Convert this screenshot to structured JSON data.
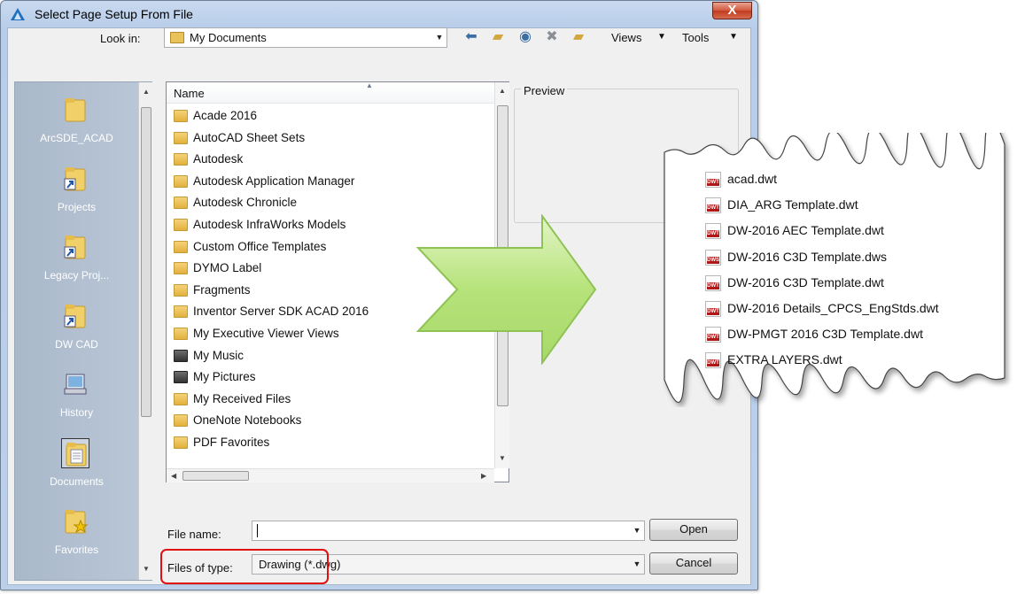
{
  "window": {
    "title": "Select Page Setup From File",
    "close_glyph": "X"
  },
  "toolbar": {
    "lookin_label": "Look in:",
    "lookin_value": "My Documents",
    "views_label": "Views",
    "tools_label": "Tools",
    "icons": [
      "back-arrow-icon",
      "up-folder-icon",
      "search-web-icon",
      "delete-icon",
      "new-folder-icon"
    ]
  },
  "places": [
    {
      "label": "ArcSDE_ACAD",
      "icon": "folder-icon"
    },
    {
      "label": "Projects",
      "icon": "folder-shortcut-icon"
    },
    {
      "label": "Legacy Proj...",
      "icon": "folder-shortcut-icon"
    },
    {
      "label": "DW CAD",
      "icon": "folder-shortcut-icon"
    },
    {
      "label": "History",
      "icon": "history-icon"
    },
    {
      "label": "Documents",
      "icon": "documents-icon",
      "selected": true
    },
    {
      "label": "Favorites",
      "icon": "favorites-folder-icon"
    }
  ],
  "filelist": {
    "column_name": "Name",
    "items": [
      "Acade 2016",
      "AutoCAD Sheet Sets",
      "Autodesk",
      "Autodesk Application Manager",
      "Autodesk Chronicle",
      "Autodesk InfraWorks Models",
      "Custom Office Templates",
      "DYMO Label",
      "Fragments",
      "Inventor Server SDK ACAD 2016",
      "My Executive Viewer Views",
      "My Music",
      "My Pictures",
      "My Received Files",
      "OneNote Notebooks",
      "PDF Favorites"
    ]
  },
  "preview": {
    "label": "Preview"
  },
  "bottom": {
    "filename_label": "File name:",
    "filename_value": "",
    "filetype_label": "Files of type:",
    "filetype_value": "Drawing (*.dwg)",
    "open_label": "Open",
    "cancel_label": "Cancel"
  },
  "callout": {
    "files": [
      {
        "name": "acad.dwt",
        "icon": "DWT"
      },
      {
        "name": "DIA_ARG Template.dwt",
        "icon": "DWT"
      },
      {
        "name": "DW-2016 AEC Template.dwt",
        "icon": "DWT"
      },
      {
        "name": "DW-2016 C3D Template.dws",
        "icon": "DWS"
      },
      {
        "name": "DW-2016 C3D Template.dwt",
        "icon": "DWT"
      },
      {
        "name": "DW-2016 Details_CPCS_EngStds.dwt",
        "icon": "DWT"
      },
      {
        "name": "DW-PMGT 2016 C3D Template.dwt",
        "icon": "DWT"
      },
      {
        "name": "EXTRA LAYERS.dwt",
        "icon": "DWT"
      }
    ]
  },
  "colors": {
    "highlight": "#e01010",
    "arrow_fill": "#b6e37a",
    "titlebar": "#bcd0ea"
  }
}
